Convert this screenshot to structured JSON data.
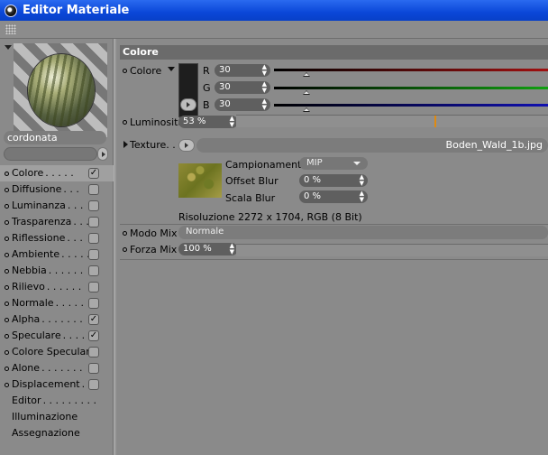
{
  "window": {
    "title": "Editor Materiale"
  },
  "material": {
    "name": "cordonata"
  },
  "channels": [
    {
      "label": "Colore",
      "dots": ". . . . .",
      "checked": true,
      "has_checkbox": true,
      "selected": true,
      "has_dot": true
    },
    {
      "label": "Diffusione",
      "dots": ". . .",
      "checked": false,
      "has_checkbox": true,
      "has_dot": true
    },
    {
      "label": "Luminanza",
      "dots": ". . .",
      "checked": false,
      "has_checkbox": true,
      "has_dot": true
    },
    {
      "label": "Trasparenza",
      "dots": ". . .",
      "checked": false,
      "has_checkbox": true,
      "has_dot": true
    },
    {
      "label": "Riflessione",
      "dots": ". . .",
      "checked": false,
      "has_checkbox": true,
      "has_dot": true
    },
    {
      "label": "Ambiente",
      "dots": ". . . . .",
      "checked": false,
      "has_checkbox": true,
      "has_dot": true
    },
    {
      "label": "Nebbia",
      "dots": ". . . . . .",
      "checked": false,
      "has_checkbox": true,
      "has_dot": true
    },
    {
      "label": "Rilievo",
      "dots": ". . . . . .",
      "checked": false,
      "has_checkbox": true,
      "has_dot": true
    },
    {
      "label": "Normale",
      "dots": ". . . . .",
      "checked": false,
      "has_checkbox": true,
      "has_dot": true
    },
    {
      "label": "Alpha",
      "dots": ". . . . . . .",
      "checked": true,
      "has_checkbox": true,
      "has_dot": true
    },
    {
      "label": "Speculare",
      "dots": ". . . .",
      "checked": true,
      "has_checkbox": true,
      "has_dot": true
    },
    {
      "label": "Colore Speculare",
      "dots": "",
      "checked": false,
      "has_checkbox": true,
      "has_dot": true
    },
    {
      "label": "Alone",
      "dots": ". . . . . . .",
      "checked": false,
      "has_checkbox": true,
      "has_dot": true
    },
    {
      "label": "Displacement",
      "dots": ". . .",
      "checked": false,
      "has_checkbox": true,
      "has_dot": true
    },
    {
      "label": "Editor",
      "dots": ". . . . . . . . .",
      "checked": false,
      "has_checkbox": false,
      "has_dot": false
    },
    {
      "label": "Illuminazione",
      "dots": "",
      "checked": false,
      "has_checkbox": false,
      "has_dot": false
    },
    {
      "label": "Assegnazione",
      "dots": "",
      "checked": false,
      "has_checkbox": false,
      "has_dot": false
    }
  ],
  "section": {
    "title": "Colore"
  },
  "color": {
    "label": "Colore",
    "swatch_hex": "#1e1e1e",
    "r": {
      "label": "R",
      "value": "30",
      "fraction": 0.118
    },
    "g": {
      "label": "G",
      "value": "30",
      "fraction": 0.118
    },
    "b": {
      "label": "B",
      "value": "30",
      "fraction": 0.118
    }
  },
  "luminosita": {
    "label": "Luminosità",
    "value": "53 %",
    "fraction": 0.53
  },
  "texture": {
    "label": "Texture. . .",
    "file": "Boden_Wald_1b.jpg"
  },
  "sampling": {
    "label": "Campionamento",
    "value": "MIP"
  },
  "offset_blur": {
    "label": "Offset Blur",
    "value": "0 %"
  },
  "scala_blur": {
    "label": "Scala Blur",
    "value": "0 %"
  },
  "resolution": "Risoluzione 2272 x 1704, RGB (8 Bit)",
  "modo_mix": {
    "label": "Modo Mix",
    "value": "Normale"
  },
  "forza_mix": {
    "label": "Forza Mix",
    "value": "100 %",
    "fraction": 1.0
  },
  "colors": {
    "titlebar": "#0a47d8",
    "r_bar": "#a01010",
    "g_bar": "#10a010",
    "b_bar": "#1010b0",
    "lum_marker": "#e08a10"
  }
}
